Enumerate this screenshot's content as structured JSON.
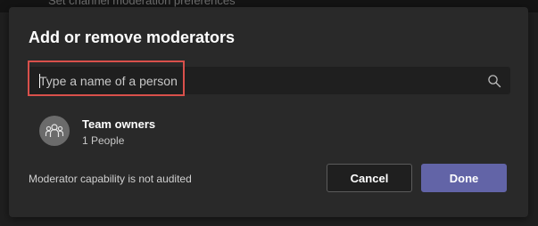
{
  "background": {
    "partial_text": "Set channel moderation preferences"
  },
  "dialog": {
    "title": "Add or remove moderators",
    "search": {
      "value": "",
      "placeholder": "Type a name of a person",
      "icon": "search-icon"
    },
    "results": [
      {
        "name": "Team owners",
        "subtitle": "1 People",
        "icon": "team-icon"
      }
    ],
    "footnote": "Moderator capability is not audited",
    "buttons": {
      "cancel_label": "Cancel",
      "done_label": "Done"
    },
    "colors": {
      "accent": "#6264a7",
      "highlight": "#d9504b",
      "dialog_bg": "#292929",
      "input_bg": "#1f1f1f"
    }
  }
}
